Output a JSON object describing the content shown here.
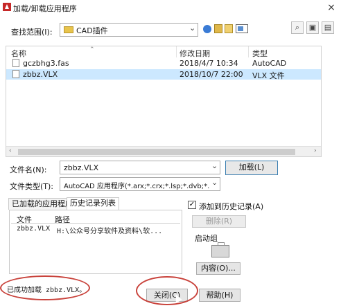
{
  "window": {
    "title": "加载/卸载应用程序",
    "close_glyph": "×"
  },
  "lookin": {
    "label": "查找范围(I):",
    "value": "CAD插件",
    "dropdown_glyph": "⌄"
  },
  "toolbar": {
    "icons": [
      "back-icon",
      "up-folder-icon",
      "new-folder-icon",
      "views-icon"
    ]
  },
  "side_icons": [
    "find-icon",
    "locate-icon",
    "web-icon"
  ],
  "file_list": {
    "headers": [
      "名称",
      "修改日期",
      "类型"
    ],
    "rows": [
      {
        "name": "gczbhg3.fas",
        "date": "2018/4/7 10:34",
        "type": "AutoCAD",
        "selected": false
      },
      {
        "name": "zbbz.VLX",
        "date": "2018/10/7 22:00",
        "type": "VLX 文件",
        "selected": true
      }
    ]
  },
  "filename": {
    "label": "文件名(N):",
    "value": "zbbz.VLX"
  },
  "filetype": {
    "label": "文件类型(T):",
    "value": "AutoCAD 应用程序(*.arx;*.crx;*.lsp;*.dvb;*.dbx;"
  },
  "load_button": "加载(L)",
  "tabs": {
    "loaded": "已加载的应用程序",
    "history": "历史记录列表"
  },
  "history_list": {
    "headers": [
      "文件",
      "路径"
    ],
    "rows": [
      {
        "file": "zbbz.VLX",
        "path": "H:\\公众号分享软件及资料\\软..."
      }
    ]
  },
  "add_history": {
    "label": "添加到历史记录(A)",
    "checked_glyph": "✓"
  },
  "remove_button": "删除(R)",
  "startup": {
    "label": "启动组",
    "contents_button": "内容(O)..."
  },
  "status_text": "已成功加载 zbbz.VLX。",
  "close_button": "关闭(C)",
  "help_button": "帮助(H)",
  "annotation_color": "#c9433c"
}
